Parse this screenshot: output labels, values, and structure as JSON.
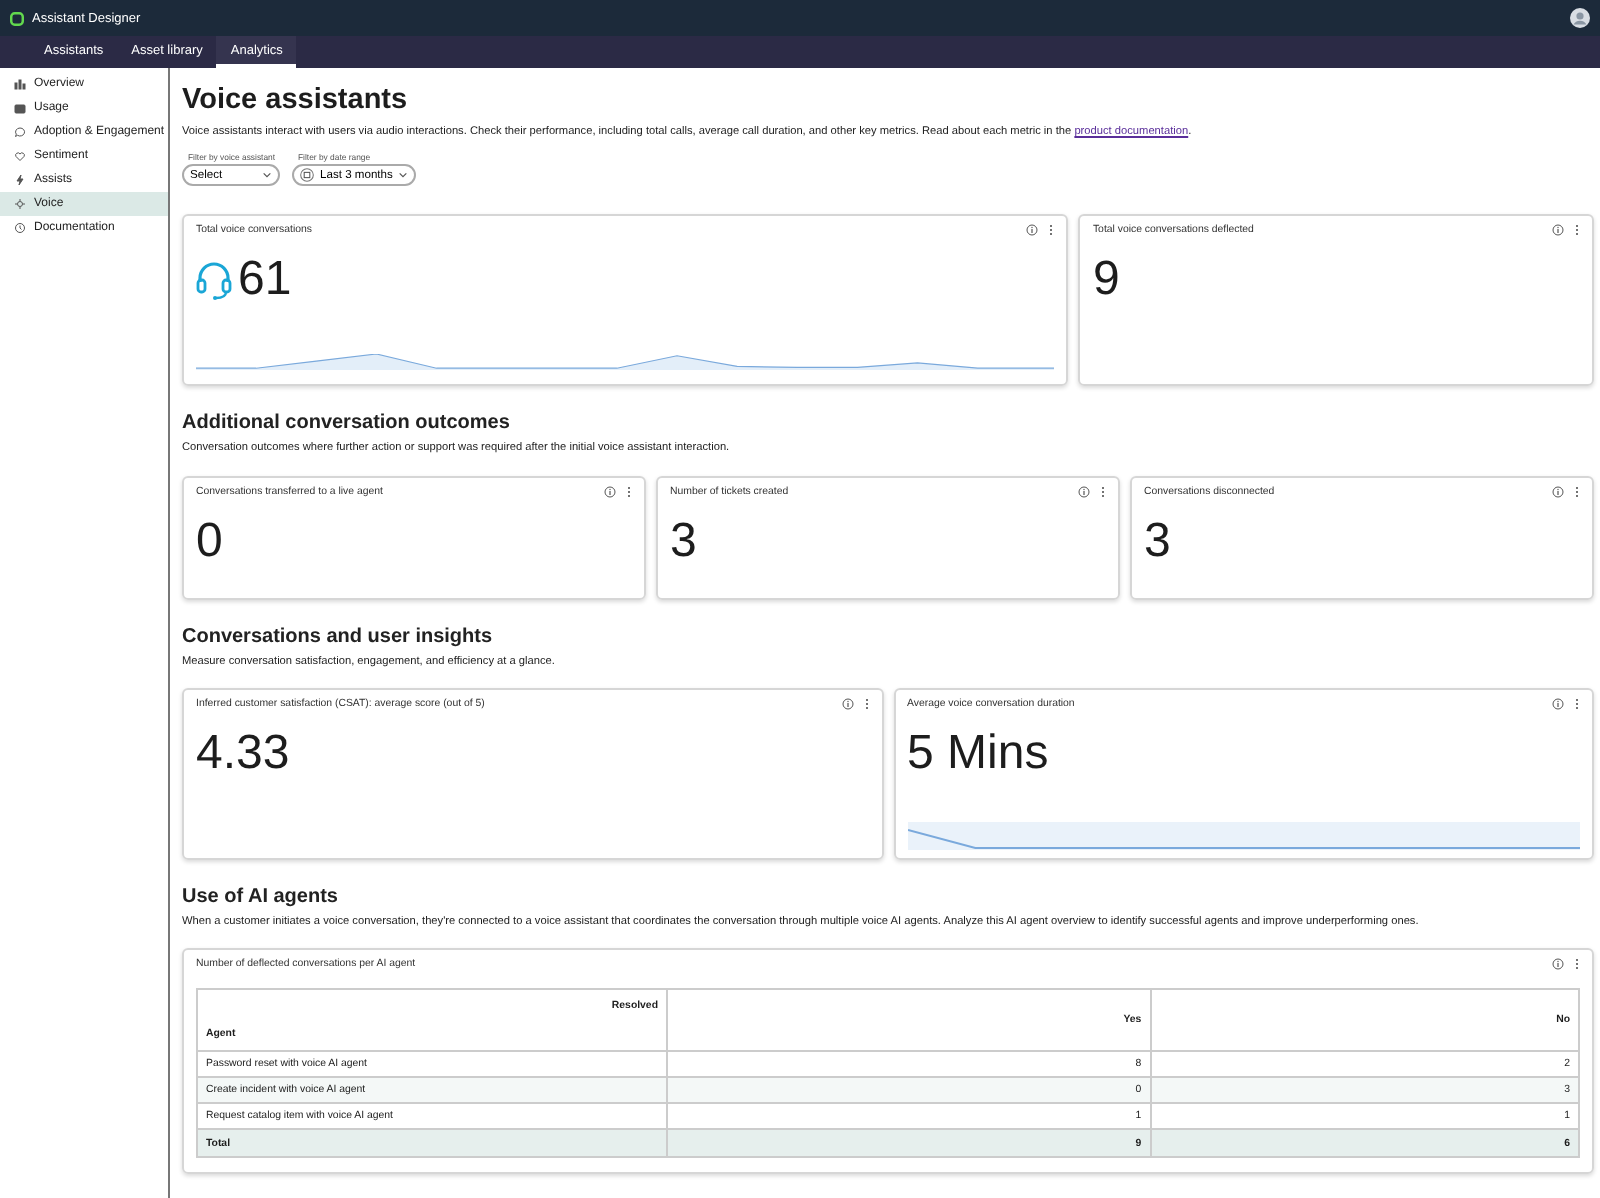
{
  "app": {
    "title": "Assistant Designer"
  },
  "nav_tabs": [
    {
      "label": "Assistants",
      "selected": false
    },
    {
      "label": "Asset library",
      "selected": false
    },
    {
      "label": "Analytics",
      "selected": true
    }
  ],
  "sidebar": {
    "items": [
      {
        "label": "Overview",
        "selected": false
      },
      {
        "label": "Usage",
        "selected": false
      },
      {
        "label": "Adoption & Engagement",
        "selected": false
      },
      {
        "label": "Sentiment",
        "selected": false
      },
      {
        "label": "Assists",
        "selected": false
      },
      {
        "label": "Voice",
        "selected": true
      },
      {
        "label": "Documentation",
        "selected": false
      }
    ]
  },
  "page": {
    "title": "Voice assistants",
    "description": "Voice assistants interact with users via audio interactions. Check their performance, including total calls, average call duration, and other key metrics. Read about each metric in the ",
    "link": "product documentation",
    "description_end": ".",
    "filters": [
      {
        "label": "Filter by voice assistant",
        "value": "Select",
        "kind": "select"
      },
      {
        "label": "Filter by date range",
        "value": "Last 3 months",
        "kind": "date"
      }
    ]
  },
  "summary_cards": [
    {
      "title": "Total voice conversations",
      "value": "61",
      "kind": "featured"
    },
    {
      "title": "Total voice conversations deflected",
      "value": "9",
      "kind": "plain"
    }
  ],
  "sections": [
    {
      "title": "Additional conversation outcomes",
      "description": "Conversation outcomes where further action or support was required after the initial voice assistant interaction.",
      "cards": [
        {
          "title": "Conversations transferred to a live agent",
          "value": "0",
          "kind": "plain"
        },
        {
          "title": "Number of tickets created",
          "value": "3",
          "kind": "plain"
        },
        {
          "title": "Conversations disconnected",
          "value": "3",
          "kind": "plain"
        }
      ]
    },
    {
      "title": "Conversations and user insights",
      "description": "Measure conversation satisfaction, engagement, and efficiency at a glance.",
      "cards": [
        {
          "title": "Inferred customer satisfaction (CSAT): average score (out of 5)",
          "value": "4.33",
          "kind": "plain"
        },
        {
          "title": "Average voice conversation duration",
          "value": "5 Mins",
          "kind": "trend"
        }
      ]
    }
  ],
  "agents": {
    "title": "Use of AI agents",
    "description": "When a customer initiates a voice conversation, they're connected to a voice assistant that coordinates the conversation through multiple voice AI agents. Analyze this AI agent overview to identify successful agents and improve underperforming ones.",
    "card_title": "Number of deflected conversations per AI agent",
    "table": {
      "group_header": "Resolved",
      "columns": [
        "Agent",
        "Yes",
        "No"
      ],
      "rows": [
        [
          "Password reset with voice AI agent",
          "8",
          "2"
        ],
        [
          "Create incident with voice AI agent",
          "0",
          "3"
        ],
        [
          "Request catalog item with voice AI agent",
          "1",
          "1"
        ]
      ],
      "total": [
        "Total",
        "9",
        "6"
      ]
    }
  }
}
